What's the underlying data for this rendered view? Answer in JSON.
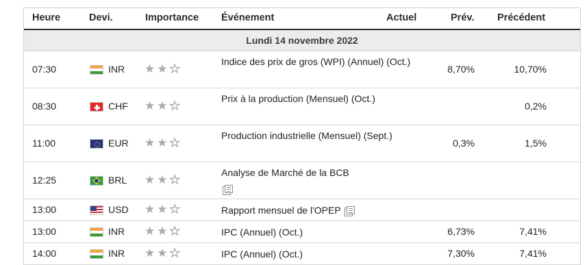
{
  "header": {
    "time": "Heure",
    "currency": "Devi.",
    "importance": "Importance",
    "event": "Événement",
    "actual": "Actuel",
    "forecast": "Prév.",
    "previous": "Précédent"
  },
  "day_label": "Lundi 14 novembre 2022",
  "star_glyphs": {
    "on": "★",
    "off": "☆"
  },
  "rows": [
    {
      "time": "07:30",
      "flag": "india-flag-icon",
      "currency": "INR",
      "importance": 2,
      "event": "Indice des prix de gros (WPI) (Annuel) (Oct.)",
      "doc": false,
      "actual": "",
      "forecast": "8,70%",
      "previous": "10,70%"
    },
    {
      "time": "08:30",
      "flag": "switzerland-flag-icon",
      "currency": "CHF",
      "importance": 2,
      "event": "Prix à la production (Mensuel) (Oct.)",
      "doc": false,
      "actual": "",
      "forecast": "",
      "previous": "0,2%"
    },
    {
      "time": "11:00",
      "flag": "eu-flag-icon",
      "currency": "EUR",
      "importance": 2,
      "event": "Production industrielle (Mensuel) (Sept.)",
      "doc": false,
      "actual": "",
      "forecast": "0,3%",
      "previous": "1,5%"
    },
    {
      "time": "12:25",
      "flag": "brazil-flag-icon",
      "currency": "BRL",
      "importance": 2,
      "event": "Analyse de Marché de la BCB",
      "doc": true,
      "actual": "",
      "forecast": "",
      "previous": ""
    },
    {
      "time": "13:00",
      "flag": "usa-flag-icon",
      "currency": "USD",
      "importance": 2,
      "event": "Rapport mensuel de l'OPEP",
      "doc": true,
      "actual": "",
      "forecast": "",
      "previous": ""
    },
    {
      "time": "13:00",
      "flag": "india-flag-icon",
      "currency": "INR",
      "importance": 2,
      "event": "IPC (Annuel) (Oct.)",
      "doc": false,
      "actual": "",
      "forecast": "6,73%",
      "previous": "7,41%"
    },
    {
      "time": "14:00",
      "flag": "india-flag-icon",
      "currency": "INR",
      "importance": 2,
      "event": "IPC (Annuel) (Oct.)",
      "doc": false,
      "actual": "",
      "forecast": "7,30%",
      "previous": "7,41%"
    }
  ]
}
